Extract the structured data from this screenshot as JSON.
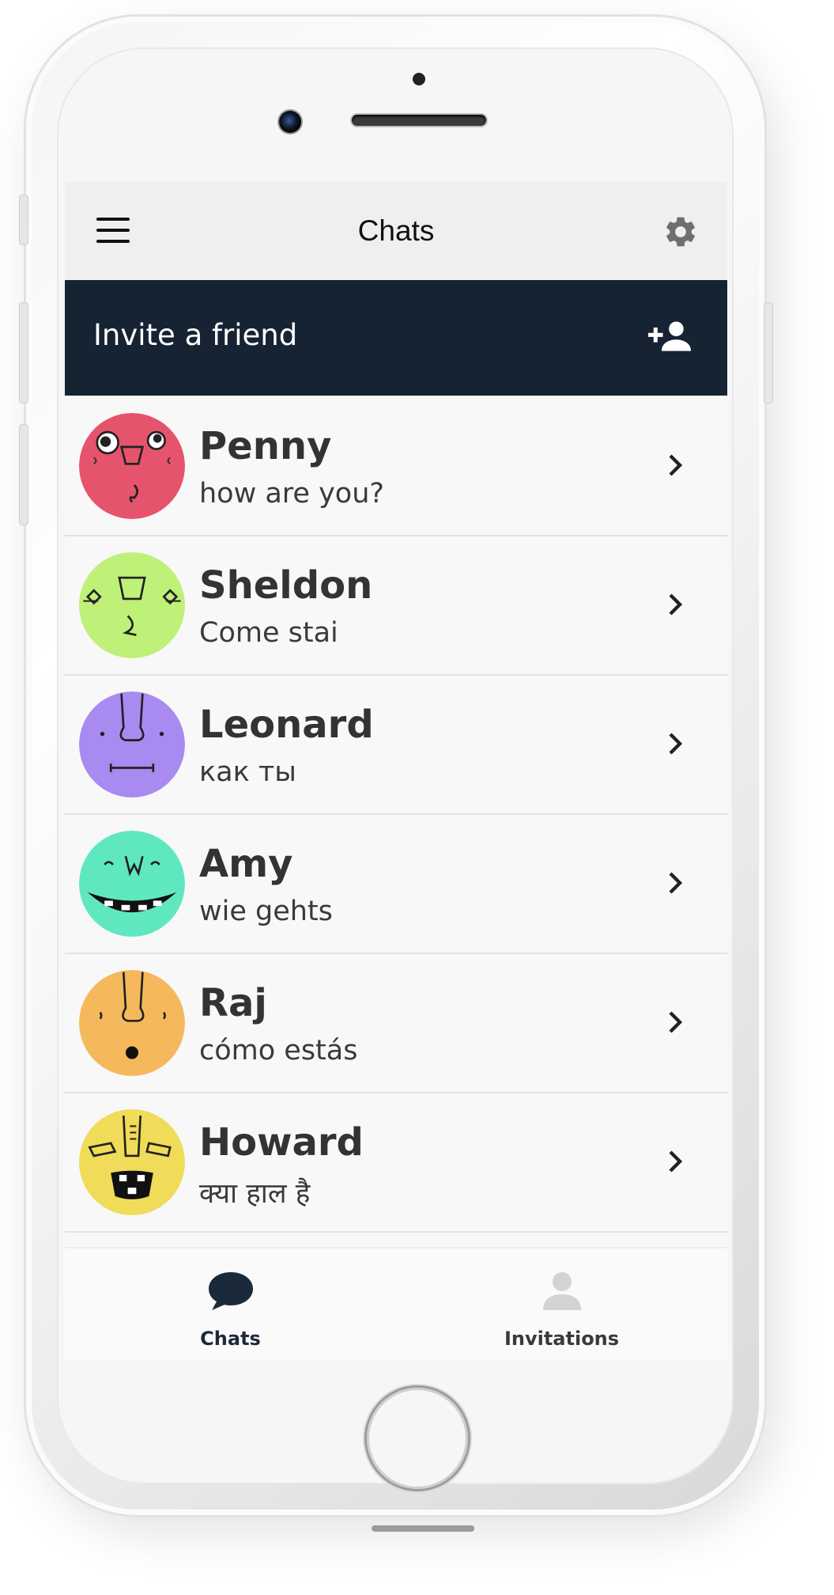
{
  "header": {
    "title": "Chats"
  },
  "invite": {
    "label": "Invite a friend"
  },
  "chats": [
    {
      "name": "Penny",
      "message": "how are you?",
      "avatar_color": "#e5546c"
    },
    {
      "name": "Sheldon",
      "message": "Come stai",
      "avatar_color": "#bff078"
    },
    {
      "name": "Leonard",
      "message": "как ты",
      "avatar_color": "#a98af0"
    },
    {
      "name": "Amy",
      "message": "wie gehts",
      "avatar_color": "#5fe8bf"
    },
    {
      "name": "Raj",
      "message": "cómo estás",
      "avatar_color": "#f5b95c"
    },
    {
      "name": "Howard",
      "message": "क्या हाल है",
      "avatar_color": "#f0dc58"
    }
  ],
  "tabs": [
    {
      "label": "Chats",
      "icon": "chat-bubble-icon",
      "active": true
    },
    {
      "label": "Invitations",
      "icon": "person-icon",
      "active": false
    }
  ],
  "colors": {
    "header_bg": "#efefef",
    "invite_bg": "#162332",
    "active_tab": "#1b2a3a",
    "inactive_tab": "#3a3a3a"
  }
}
